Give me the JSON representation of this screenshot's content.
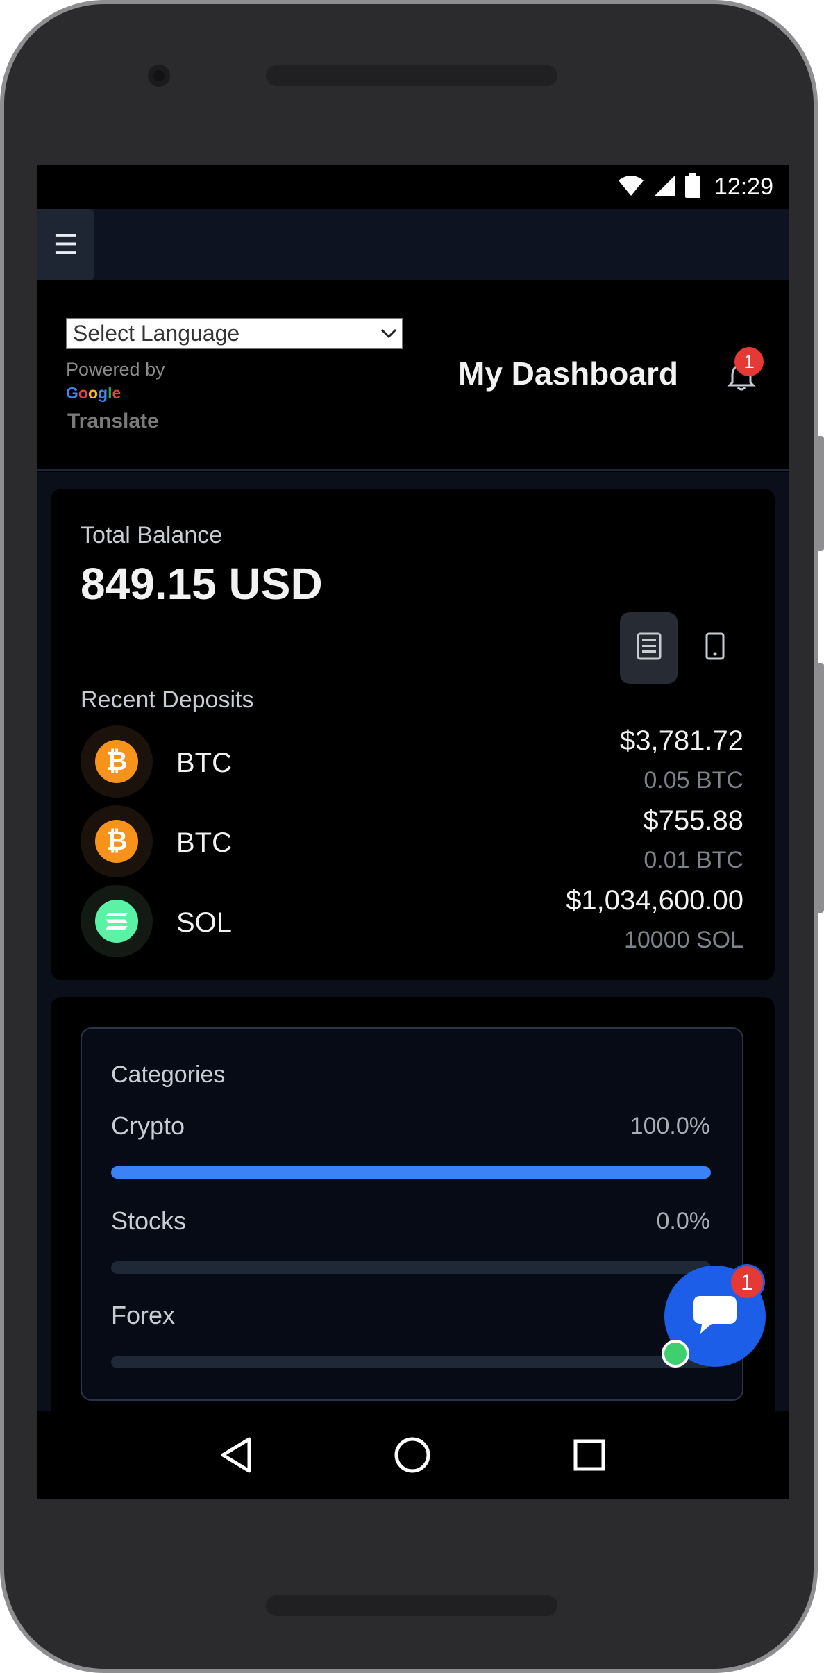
{
  "status_bar": {
    "time": "12:29",
    "icons": [
      "wifi-icon",
      "signal-icon",
      "battery-icon"
    ]
  },
  "app_bar": {
    "menu_icon": "hamburger-menu-icon"
  },
  "header": {
    "language_select": {
      "selected": "Select Language"
    },
    "powered_by": "Powered by",
    "google": "Google",
    "translate": "Translate",
    "title": "My Dashboard",
    "notification_count": "1"
  },
  "balance": {
    "label": "Total Balance",
    "value": "849.15 USD",
    "view_icons": [
      "list-view-icon",
      "phone-view-icon"
    ]
  },
  "recent_deposits": {
    "label": "Recent Deposits",
    "items": [
      {
        "symbol": "BTC",
        "usd": "$3,781.72",
        "amount": "0.05 BTC",
        "coin_color": "#f7931a"
      },
      {
        "symbol": "BTC",
        "usd": "$755.88",
        "amount": "0.01 BTC",
        "coin_color": "#f7931a"
      },
      {
        "symbol": "SOL",
        "usd": "$1,034,600.00",
        "amount": "10000 SOL",
        "coin_color": "#5cf2a5"
      }
    ]
  },
  "categories": {
    "title": "Categories",
    "items": [
      {
        "name": "Crypto",
        "percent": "100.0%",
        "fill": 1.0
      },
      {
        "name": "Stocks",
        "percent": "0.0%",
        "fill": 0.0
      },
      {
        "name": "Forex",
        "percent": "0",
        "fill": 0.0
      }
    ]
  },
  "chat": {
    "badge_count": "1"
  },
  "colors": {
    "accent": "#3b82f6",
    "badge": "#e53935",
    "chat": "#1d5ee8",
    "online": "#3ecf6e"
  }
}
